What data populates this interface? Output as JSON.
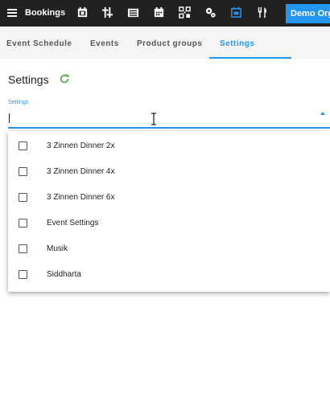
{
  "app": {
    "title": "Bookings",
    "account_button": "Demo Org"
  },
  "toolbar_icons": [
    "calendar-icon",
    "tune-icon",
    "list-icon",
    "calendar-grid-icon",
    "qr-code-icon",
    "settings-icon",
    "event-icon",
    "restaurant-icon"
  ],
  "tabs": [
    {
      "label": "Event Schedule"
    },
    {
      "label": "Events"
    },
    {
      "label": "Product groups"
    },
    {
      "label": "Settings"
    }
  ],
  "page": {
    "title": "Settings"
  },
  "field": {
    "label": "Settings",
    "value": "",
    "placeholder": ""
  },
  "options": [
    {
      "label": "3 Zinnen Dinner 2x",
      "checked": false
    },
    {
      "label": "3 Zinnen Dinner 4x",
      "checked": false
    },
    {
      "label": "3 Zinnen Dinner 6x",
      "checked": false
    },
    {
      "label": "Event Settings",
      "checked": false
    },
    {
      "label": "Musik",
      "checked": false
    },
    {
      "label": "Siddharta",
      "checked": false
    }
  ],
  "colors": {
    "topbar": "#212121",
    "accent": "#2196f3",
    "refresh": "#4caf50"
  }
}
